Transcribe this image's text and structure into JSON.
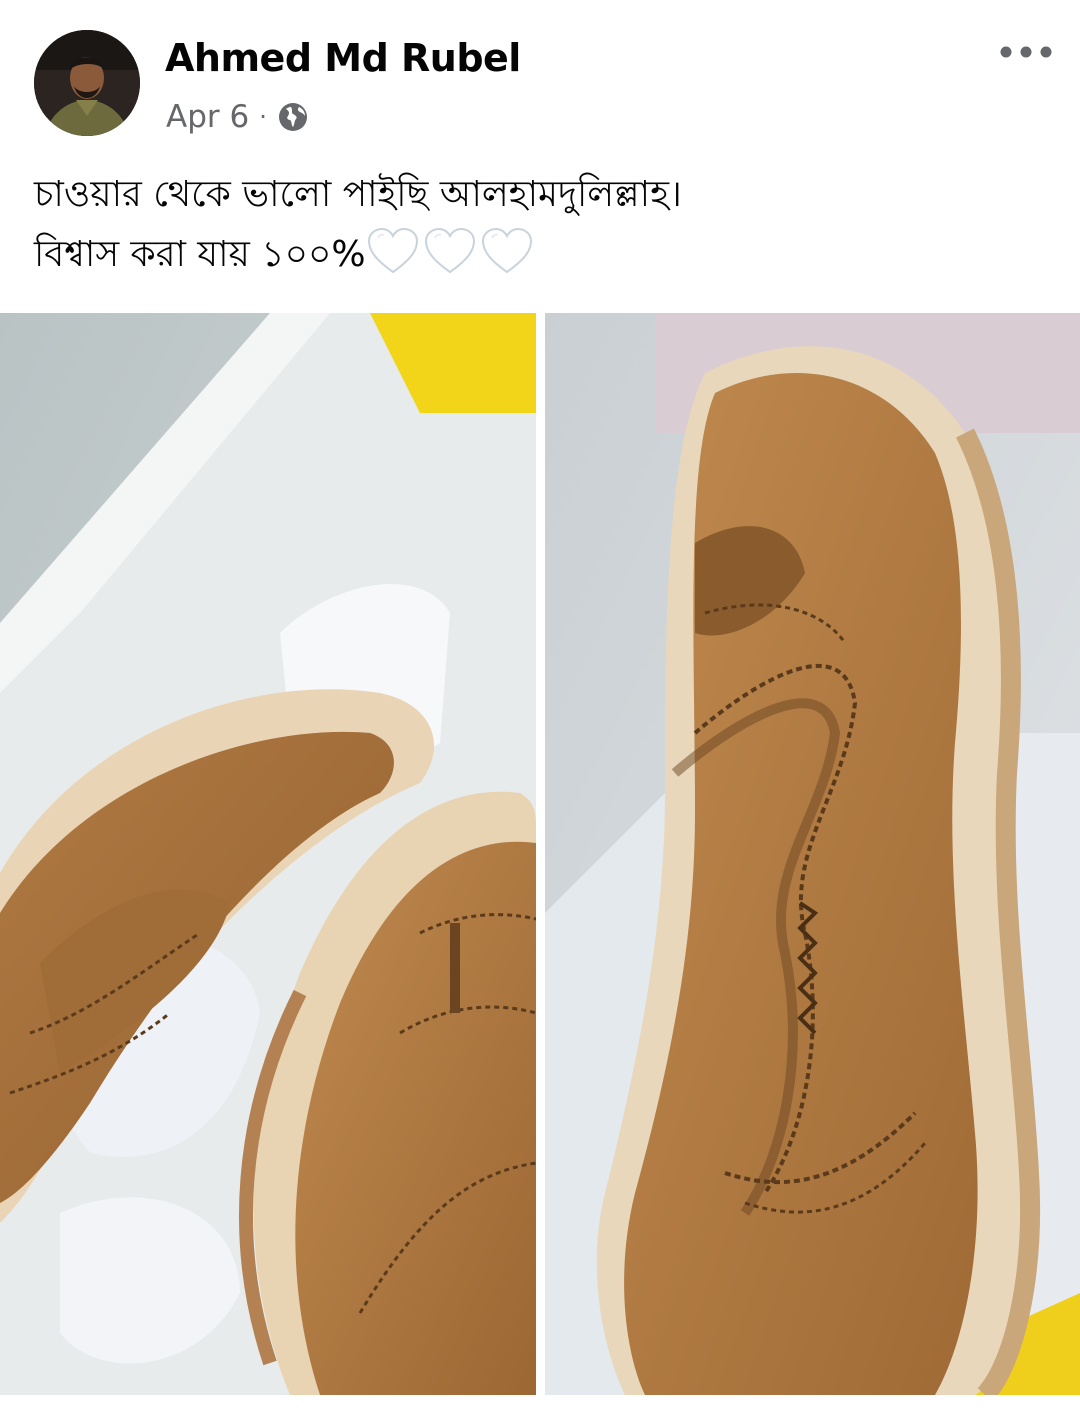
{
  "post": {
    "author_name": "Ahmed Md Rubel",
    "timestamp": "Apr 6",
    "separator": "·",
    "privacy_icon": "globe-icon",
    "more_icon": "more-horizontal-icon",
    "text_line_1": "চাওয়ার থেকে ভালো পাইছি আলহামদুলিল্লাহ।",
    "text_line_2": "বিশ্বাস করা যায় ১০০%",
    "emoji": [
      "white-heart-icon",
      "white-heart-icon",
      "white-heart-icon"
    ],
    "photos": [
      "shoe-photo-left",
      "shoe-photo-right"
    ]
  },
  "colors": {
    "name_text": "#050505",
    "meta_text": "#65676b",
    "shoe_tan": "#a9753f",
    "sole_cream": "#ead8bd",
    "box_yellow": "#f2d418"
  }
}
